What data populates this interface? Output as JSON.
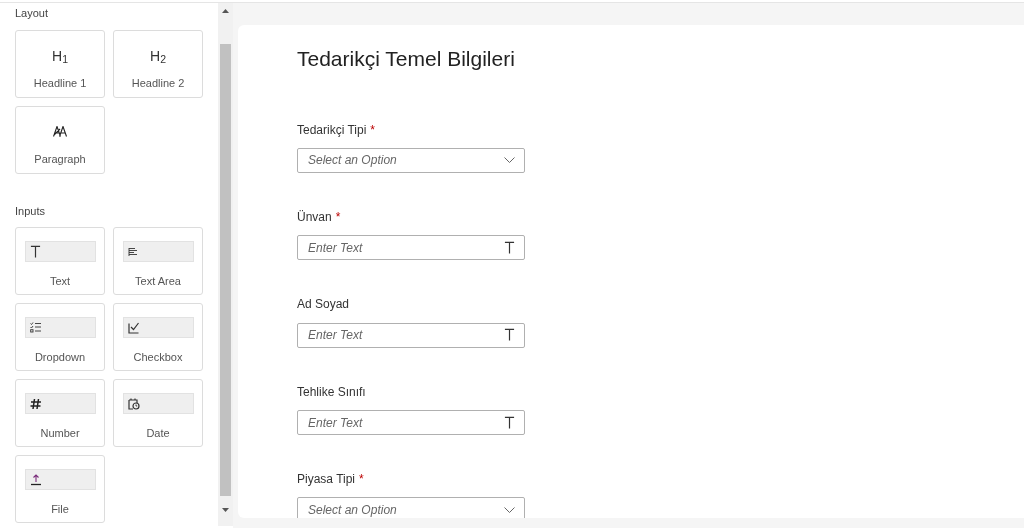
{
  "sidebar": {
    "sections": [
      {
        "title": "Layout",
        "items": [
          {
            "kind": "heading",
            "glyph": "H$_{1}$",
            "label": "Headline 1"
          },
          {
            "kind": "heading",
            "glyph": "H$_{2}$",
            "label": "Headline 2"
          },
          {
            "kind": "paragraph",
            "label": "Paragraph"
          }
        ]
      },
      {
        "title": "Inputs",
        "items": [
          {
            "kind": "text",
            "label": "Text"
          },
          {
            "kind": "textarea",
            "label": "Text Area"
          },
          {
            "kind": "dropdown",
            "label": "Dropdown"
          },
          {
            "kind": "checkbox",
            "label": "Checkbox"
          },
          {
            "kind": "number",
            "label": "Number"
          },
          {
            "kind": "date",
            "label": "Date"
          },
          {
            "kind": "file",
            "label": "File"
          }
        ]
      }
    ]
  },
  "form": {
    "title": "Tedarikçi Temel Bilgileri",
    "fields": [
      {
        "kind": "select",
        "label": "Tedarikçi Tipi",
        "required_mark": "*",
        "placeholder": "Select an Option"
      },
      {
        "kind": "text",
        "label": "Ünvan",
        "required_mark": "*",
        "placeholder": "Enter Text"
      },
      {
        "kind": "text",
        "label": "Ad Soyad",
        "placeholder": "Enter Text"
      },
      {
        "kind": "text",
        "label": "Tehlike Sınıfı",
        "placeholder": "Enter Text"
      },
      {
        "kind": "select",
        "label": "Piyasa Tipi",
        "required_mark": "*",
        "placeholder": "Select an Option"
      }
    ]
  }
}
